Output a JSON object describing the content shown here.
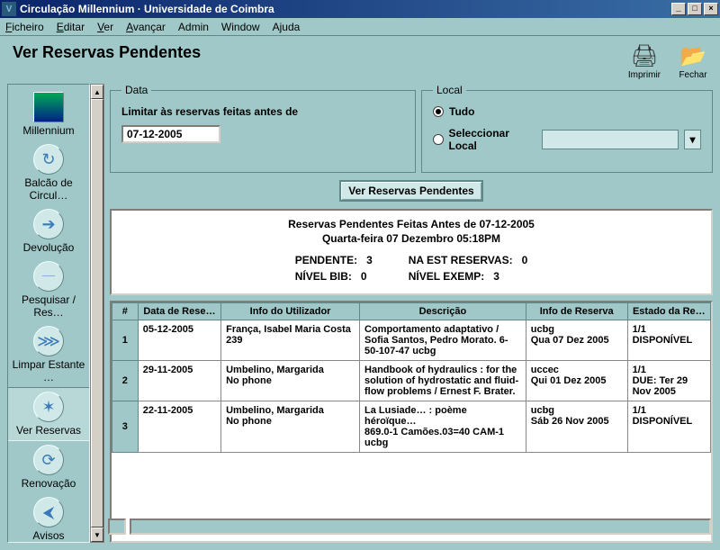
{
  "window": {
    "title": "Circulação Millennium · Universidade de Coimbra"
  },
  "menu": [
    "Ficheiro",
    "Editar",
    "Ver",
    "Avançar",
    "Admin",
    "Window",
    "Ajuda"
  ],
  "menuKeys": [
    "F",
    "E",
    "V",
    "A",
    "",
    "",
    ""
  ],
  "page": {
    "title": "Ver Reservas Pendentes"
  },
  "actions": {
    "print": "Imprimir",
    "close": "Fechar"
  },
  "sidebar": {
    "items": [
      {
        "label": "Millennium"
      },
      {
        "label": "Balcão de Circul…"
      },
      {
        "label": "Devolução"
      },
      {
        "label": "Pesquisar / Res…"
      },
      {
        "label": "Limpar Estante …"
      },
      {
        "label": "Ver Reservas"
      },
      {
        "label": "Renovação"
      },
      {
        "label": "Avisos"
      }
    ]
  },
  "filters": {
    "data": {
      "legend": "Data",
      "label": "Limitar às reservas feitas antes de",
      "value": "07-12-2005"
    },
    "local": {
      "legend": "Local",
      "optAll": "Tudo",
      "optSelect": "Seleccionar Local",
      "selected": "all"
    }
  },
  "actionButton": "Ver Reservas Pendentes",
  "report": {
    "title": "Reservas Pendentes Feitas Antes de 07-12-2005",
    "subtitle": "Quarta-feira 07 Dezembro 05:18PM",
    "stats": {
      "pendente_k": "PENDENTE:",
      "pendente_v": "3",
      "naest_k": "NA EST RESERVAS:",
      "naest_v": "0",
      "nivbib_k": "NÍVEL BIB:",
      "nivbib_v": "0",
      "nivexemp_k": "NÍVEL EXEMP:",
      "nivexemp_v": "3"
    }
  },
  "table": {
    "headers": [
      "#",
      "Data de Rese…",
      "Info do Utilizador",
      "Descrição",
      "Info de Reserva",
      "Estado da Re…"
    ],
    "rows": [
      {
        "n": "1",
        "date": "05-12-2005",
        "user": "França, Isabel Maria Costa\n239",
        "desc": "Comportamento adaptativo / Sofia Santos, Pedro Morato. 6-50-107-47 ucbg",
        "reserve": "ucbg\nQua 07 Dez 2005",
        "status": "1/1\nDISPONÍVEL"
      },
      {
        "n": "2",
        "date": "29-11-2005",
        "user": "Umbelino, Margarida\nNo phone",
        "desc": "Handbook of hydraulics : for the solution of hydrostatic and fluid-flow problems / Ernest F. Brater.",
        "reserve": "uccec\nQui 01 Dez 2005",
        "status": "1/1\nDUE: Ter 29 Nov 2005"
      },
      {
        "n": "3",
        "date": "22-11-2005",
        "user": "Umbelino, Margarida\nNo phone",
        "desc": "La Lusiade… : poème héroïque…\n869.0-1 Camões.03=40 CAM-1 ucbg",
        "reserve": "ucbg\nSáb 26 Nov 2005",
        "status": "1/1\nDISPONÍVEL"
      }
    ]
  }
}
